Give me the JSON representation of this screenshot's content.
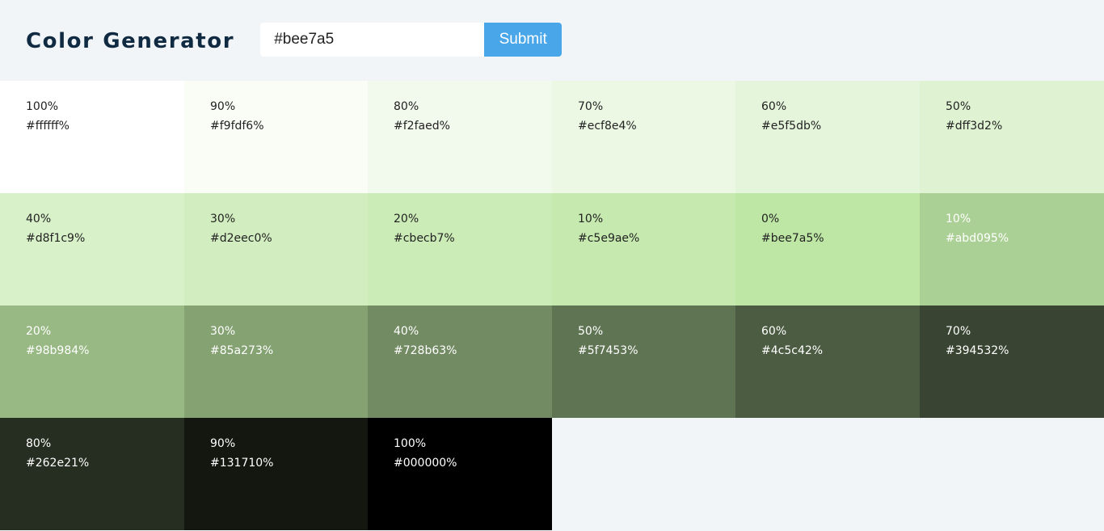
{
  "header": {
    "title": "Color Generator",
    "input_value": "#bee7a5",
    "submit_label": "Submit"
  },
  "colors": {
    "light_text": "#ffffff",
    "dark_text": "#222222",
    "accent": "#49a6e9",
    "title": "#102a42"
  },
  "swatches": [
    {
      "pct": "100%",
      "hex": "#ffffff%",
      "color": "#ffffff",
      "dark": false
    },
    {
      "pct": "90%",
      "hex": "#f9fdf6%",
      "color": "#f9fdf6",
      "dark": false
    },
    {
      "pct": "80%",
      "hex": "#f2faed%",
      "color": "#f2faed",
      "dark": false
    },
    {
      "pct": "70%",
      "hex": "#ecf8e4%",
      "color": "#ecf8e4",
      "dark": false
    },
    {
      "pct": "60%",
      "hex": "#e5f5db%",
      "color": "#e5f5db",
      "dark": false
    },
    {
      "pct": "50%",
      "hex": "#dff3d2%",
      "color": "#dff3d2",
      "dark": false
    },
    {
      "pct": "40%",
      "hex": "#d8f1c9%",
      "color": "#d8f1c9",
      "dark": false
    },
    {
      "pct": "30%",
      "hex": "#d2eec0%",
      "color": "#d2eec0",
      "dark": false
    },
    {
      "pct": "20%",
      "hex": "#cbecb7%",
      "color": "#cbecb7",
      "dark": false
    },
    {
      "pct": "10%",
      "hex": "#c5e9ae%",
      "color": "#c5e9ae",
      "dark": false
    },
    {
      "pct": "0%",
      "hex": "#bee7a5%",
      "color": "#bee7a5",
      "dark": false
    },
    {
      "pct": "10%",
      "hex": "#abd095%",
      "color": "#abd095",
      "dark": true
    },
    {
      "pct": "20%",
      "hex": "#98b984%",
      "color": "#98b984",
      "dark": true
    },
    {
      "pct": "30%",
      "hex": "#85a273%",
      "color": "#85a273",
      "dark": true
    },
    {
      "pct": "40%",
      "hex": "#728b63%",
      "color": "#728b63",
      "dark": true
    },
    {
      "pct": "50%",
      "hex": "#5f7453%",
      "color": "#5f7453",
      "dark": true
    },
    {
      "pct": "60%",
      "hex": "#4c5c42%",
      "color": "#4c5c42",
      "dark": true
    },
    {
      "pct": "70%",
      "hex": "#394532%",
      "color": "#394532",
      "dark": true
    },
    {
      "pct": "80%",
      "hex": "#262e21%",
      "color": "#262e21",
      "dark": true
    },
    {
      "pct": "90%",
      "hex": "#131710%",
      "color": "#131710",
      "dark": true
    },
    {
      "pct": "100%",
      "hex": "#000000%",
      "color": "#000000",
      "dark": true
    }
  ]
}
